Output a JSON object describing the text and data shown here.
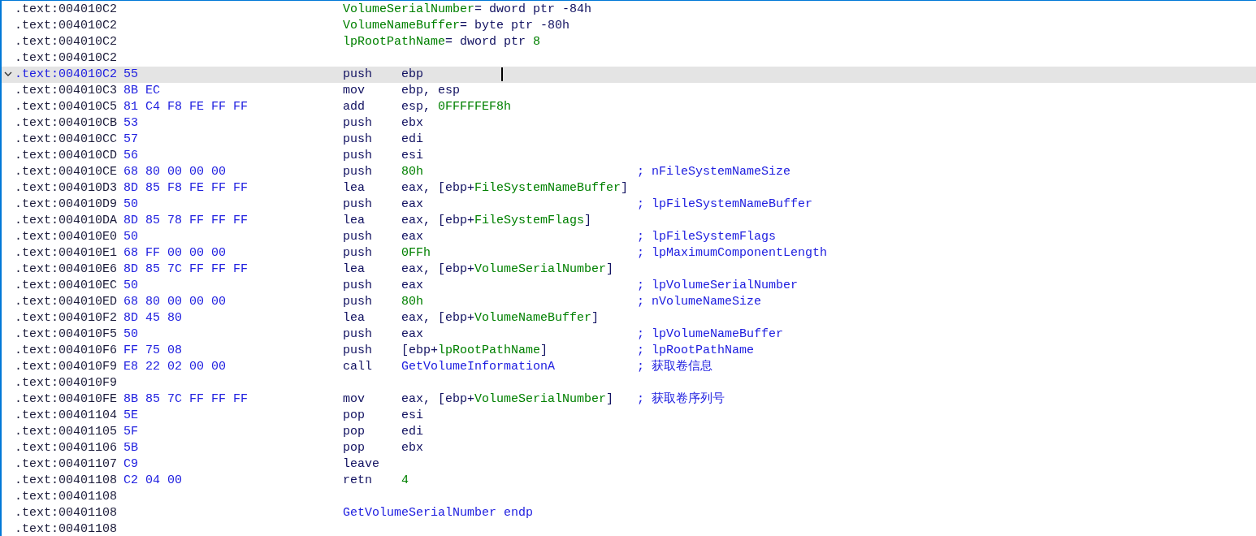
{
  "rows": [
    {
      "address": ".text:004010C2",
      "code": [
        {
          "text": "VolumeSerialNumber",
          "kind": "name"
        },
        {
          "text": "= dword ptr -84h",
          "kind": "plain"
        }
      ]
    },
    {
      "address": ".text:004010C2",
      "code": [
        {
          "text": "VolumeNameBuffer",
          "kind": "name"
        },
        {
          "text": "= byte ptr -80h",
          "kind": "plain"
        }
      ]
    },
    {
      "address": ".text:004010C2",
      "code": [
        {
          "text": "lpRootPathName",
          "kind": "name"
        },
        {
          "text": "= dword ptr  ",
          "kind": "plain"
        },
        {
          "text": "8",
          "kind": "number"
        }
      ]
    },
    {
      "address": ".text:004010C2"
    },
    {
      "address": ".text:004010C2",
      "bytes": "55",
      "mnemonic": "push",
      "operands": [
        {
          "text": "ebp",
          "kind": "plain"
        }
      ],
      "selected": true,
      "expanded": true
    },
    {
      "address": ".text:004010C3",
      "bytes": "8B EC",
      "mnemonic": "mov",
      "operands": [
        {
          "text": "ebp, esp",
          "kind": "plain"
        }
      ],
      "selected": false
    },
    {
      "address": ".text:004010C5",
      "bytes": "81 C4 F8 FE FF FF",
      "mnemonic": "add",
      "operands": [
        {
          "text": "esp, ",
          "kind": "plain"
        },
        {
          "text": "0FFFFFEF8h",
          "kind": "number"
        }
      ],
      "selected": false
    },
    {
      "address": ".text:004010CB",
      "bytes": "53",
      "mnemonic": "push",
      "operands": [
        {
          "text": "ebx",
          "kind": "plain"
        }
      ],
      "selected": false
    },
    {
      "address": ".text:004010CC",
      "bytes": "57",
      "mnemonic": "push",
      "operands": [
        {
          "text": "edi",
          "kind": "plain"
        }
      ],
      "selected": false
    },
    {
      "address": ".text:004010CD",
      "bytes": "56",
      "mnemonic": "push",
      "operands": [
        {
          "text": "esi",
          "kind": "plain"
        }
      ],
      "selected": false
    },
    {
      "address": ".text:004010CE",
      "bytes": "68 80 00 00 00",
      "mnemonic": "push",
      "operands": [
        {
          "text": "80h",
          "kind": "number"
        }
      ],
      "comment": "; nFileSystemNameSize",
      "selected": false
    },
    {
      "address": ".text:004010D3",
      "bytes": "8D 85 F8 FE FF FF",
      "mnemonic": "lea",
      "operands": [
        {
          "text": "eax, [ebp+",
          "kind": "plain"
        },
        {
          "text": "FileSystemNameBuffer",
          "kind": "name"
        },
        {
          "text": "]",
          "kind": "plain"
        }
      ],
      "selected": false
    },
    {
      "address": ".text:004010D9",
      "bytes": "50",
      "mnemonic": "push",
      "operands": [
        {
          "text": "eax",
          "kind": "plain"
        }
      ],
      "comment": "; lpFileSystemNameBuffer",
      "selected": false
    },
    {
      "address": ".text:004010DA",
      "bytes": "8D 85 78 FF FF FF",
      "mnemonic": "lea",
      "operands": [
        {
          "text": "eax, [ebp+",
          "kind": "plain"
        },
        {
          "text": "FileSystemFlags",
          "kind": "name"
        },
        {
          "text": "]",
          "kind": "plain"
        }
      ],
      "selected": false
    },
    {
      "address": ".text:004010E0",
      "bytes": "50",
      "mnemonic": "push",
      "operands": [
        {
          "text": "eax",
          "kind": "plain"
        }
      ],
      "comment": "; lpFileSystemFlags",
      "selected": false
    },
    {
      "address": ".text:004010E1",
      "bytes": "68 FF 00 00 00",
      "mnemonic": "push",
      "operands": [
        {
          "text": "0FFh",
          "kind": "number"
        }
      ],
      "comment": "; lpMaximumComponentLength",
      "selected": false
    },
    {
      "address": ".text:004010E6",
      "bytes": "8D 85 7C FF FF FF",
      "mnemonic": "lea",
      "operands": [
        {
          "text": "eax, [ebp+",
          "kind": "plain"
        },
        {
          "text": "VolumeSerialNumber",
          "kind": "name"
        },
        {
          "text": "]",
          "kind": "plain"
        }
      ],
      "selected": false
    },
    {
      "address": ".text:004010EC",
      "bytes": "50",
      "mnemonic": "push",
      "operands": [
        {
          "text": "eax",
          "kind": "plain"
        }
      ],
      "comment": "; lpVolumeSerialNumber",
      "selected": false
    },
    {
      "address": ".text:004010ED",
      "bytes": "68 80 00 00 00",
      "mnemonic": "push",
      "operands": [
        {
          "text": "80h",
          "kind": "number"
        }
      ],
      "comment": "; nVolumeNameSize",
      "selected": false
    },
    {
      "address": ".text:004010F2",
      "bytes": "8D 45 80",
      "mnemonic": "lea",
      "operands": [
        {
          "text": "eax, [ebp+",
          "kind": "plain"
        },
        {
          "text": "VolumeNameBuffer",
          "kind": "name"
        },
        {
          "text": "]",
          "kind": "plain"
        }
      ],
      "selected": false
    },
    {
      "address": ".text:004010F5",
      "bytes": "50",
      "mnemonic": "push",
      "operands": [
        {
          "text": "eax",
          "kind": "plain"
        }
      ],
      "comment": "; lpVolumeNameBuffer",
      "selected": false
    },
    {
      "address": ".text:004010F6",
      "bytes": "FF 75 08",
      "mnemonic": "push",
      "operands": [
        {
          "text": "[ebp+",
          "kind": "plain"
        },
        {
          "text": "lpRootPathName",
          "kind": "name"
        },
        {
          "text": "]",
          "kind": "plain"
        }
      ],
      "comment": "; lpRootPathName",
      "selected": false
    },
    {
      "address": ".text:004010F9",
      "bytes": "E8 22 02 00 00",
      "mnemonic": "call",
      "operands": [
        {
          "text": "GetVolumeInformationA",
          "kind": "func"
        }
      ],
      "comment": "; 获取卷信息",
      "selected": false
    },
    {
      "address": ".text:004010F9"
    },
    {
      "address": ".text:004010FE",
      "bytes": "8B 85 7C FF FF FF",
      "mnemonic": "mov",
      "operands": [
        {
          "text": "eax, [ebp+",
          "kind": "plain"
        },
        {
          "text": "VolumeSerialNumber",
          "kind": "name"
        },
        {
          "text": "]",
          "kind": "plain"
        }
      ],
      "comment": "; 获取卷序列号",
      "selected": false
    },
    {
      "address": ".text:00401104",
      "bytes": "5E",
      "mnemonic": "pop",
      "operands": [
        {
          "text": "esi",
          "kind": "plain"
        }
      ],
      "selected": false
    },
    {
      "address": ".text:00401105",
      "bytes": "5F",
      "mnemonic": "pop",
      "operands": [
        {
          "text": "edi",
          "kind": "plain"
        }
      ],
      "selected": false
    },
    {
      "address": ".text:00401106",
      "bytes": "5B",
      "mnemonic": "pop",
      "operands": [
        {
          "text": "ebx",
          "kind": "plain"
        }
      ],
      "selected": false
    },
    {
      "address": ".text:00401107",
      "bytes": "C9",
      "mnemonic": "leave",
      "selected": false
    },
    {
      "address": ".text:00401108",
      "bytes": "C2 04 00",
      "mnemonic": "retn",
      "operands": [
        {
          "text": "4",
          "kind": "number"
        }
      ],
      "selected": false
    },
    {
      "address": ".text:00401108"
    },
    {
      "address": ".text:00401108",
      "code": [
        {
          "text": "GetVolumeSerialNumber endp",
          "kind": "func"
        }
      ]
    },
    {
      "address": ".text:00401108"
    }
  ]
}
